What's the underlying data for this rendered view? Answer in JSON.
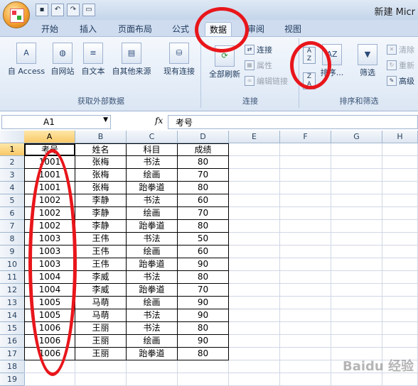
{
  "window": {
    "title": "新建 Micr"
  },
  "quick_access": [
    "save-icon",
    "undo-icon",
    "redo-icon",
    "print-preview-icon"
  ],
  "ribbon": {
    "tabs": [
      "开始",
      "插入",
      "页面布局",
      "公式",
      "数据",
      "审阅",
      "视图"
    ],
    "active_tab": "数据",
    "external_data": {
      "label": "获取外部数据",
      "buttons": [
        "自 Access",
        "自网站",
        "自文本",
        "自其他来源",
        "现有连接"
      ]
    },
    "connections": {
      "label": "连接",
      "refresh_all": "全部刷新",
      "small": [
        "连接",
        "属性",
        "编辑链接"
      ]
    },
    "sort_filter": {
      "label": "排序和筛选",
      "sort": "排序...",
      "filter": "筛选",
      "small": [
        "清除",
        "重新",
        "高级"
      ]
    }
  },
  "formula_bar": {
    "name_box": "A1",
    "fx": "fx",
    "content": "考号"
  },
  "sheet": {
    "columns": [
      "A",
      "B",
      "C",
      "D",
      "E",
      "F",
      "G",
      "H"
    ],
    "row_numbers": [
      "1",
      "2",
      "3",
      "4",
      "5",
      "6",
      "7",
      "8",
      "9",
      "10",
      "11",
      "12",
      "13",
      "14",
      "15",
      "16",
      "17",
      "18",
      "19"
    ],
    "rows": [
      [
        "考号",
        "姓名",
        "科目",
        "成绩"
      ],
      [
        "1001",
        "张梅",
        "书法",
        "80"
      ],
      [
        "1001",
        "张梅",
        "绘画",
        "70"
      ],
      [
        "1001",
        "张梅",
        "跆拳道",
        "80"
      ],
      [
        "1002",
        "李静",
        "书法",
        "60"
      ],
      [
        "1002",
        "李静",
        "绘画",
        "70"
      ],
      [
        "1002",
        "李静",
        "跆拳道",
        "80"
      ],
      [
        "1003",
        "王伟",
        "书法",
        "50"
      ],
      [
        "1003",
        "王伟",
        "绘画",
        "60"
      ],
      [
        "1003",
        "王伟",
        "跆拳道",
        "90"
      ],
      [
        "1004",
        "李威",
        "书法",
        "80"
      ],
      [
        "1004",
        "李威",
        "跆拳道",
        "70"
      ],
      [
        "1005",
        "马萌",
        "绘画",
        "90"
      ],
      [
        "1005",
        "马萌",
        "书法",
        "90"
      ],
      [
        "1006",
        "王丽",
        "书法",
        "80"
      ],
      [
        "1006",
        "王丽",
        "绘画",
        "90"
      ],
      [
        "1006",
        "王丽",
        "跆拳道",
        "80"
      ]
    ]
  },
  "watermark": "Baidu 经验",
  "annotation_color": "#e8161b"
}
